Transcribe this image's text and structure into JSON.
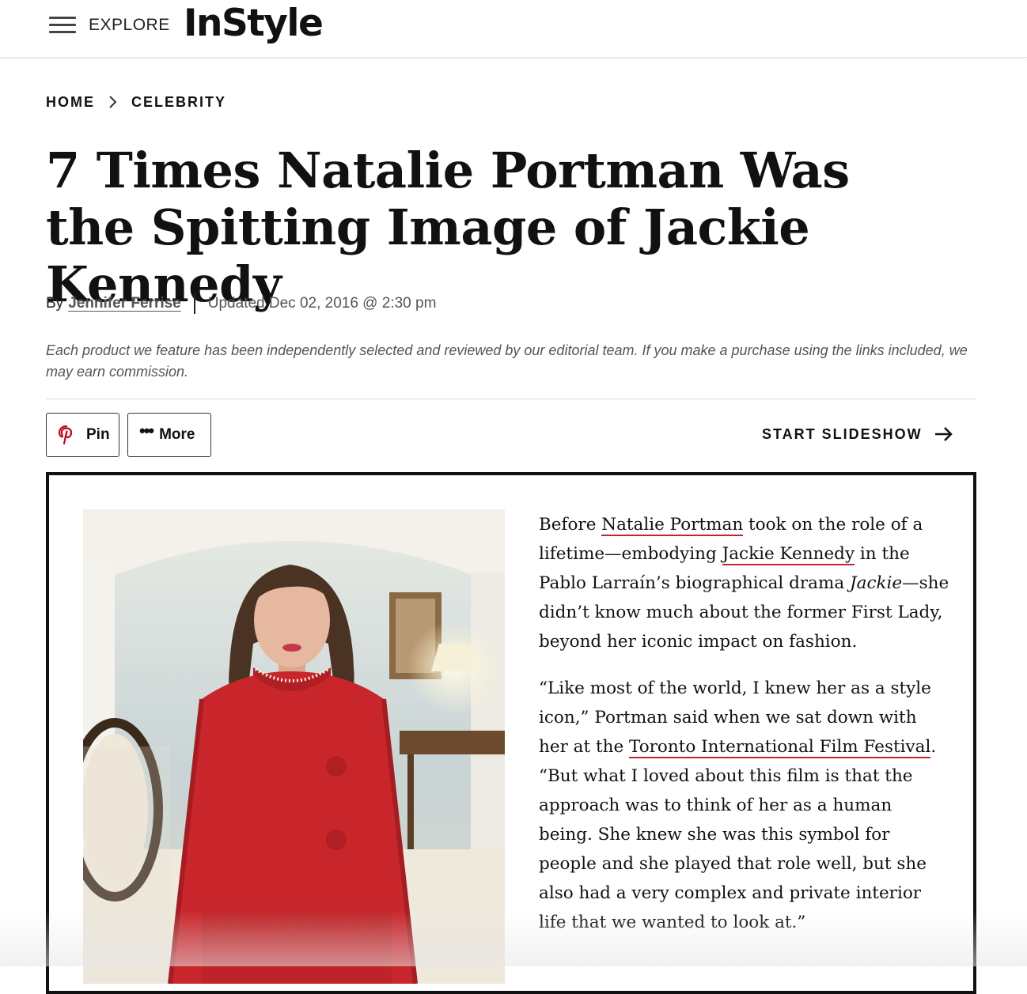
{
  "header": {
    "menu_icon": "hamburger-icon",
    "explore_label": "EXPLORE",
    "logo_text": "InStyle"
  },
  "breadcrumb": {
    "items": [
      "HOME",
      "CELEBRITY"
    ],
    "separator_icon": "chevron-right-icon"
  },
  "article": {
    "title": "7 Times Natalie Portman Was the Spitting Image of Jackie Kennedy",
    "byline_prefix": "By",
    "author": "Jennifer Ferrise",
    "updated": "Updated Dec 02, 2016 @ 2:30 pm",
    "disclaimer": "Each product we feature has been independently selected and reviewed by our editorial team. If you make a purchase using the links included, we may earn commission."
  },
  "actions": {
    "pin_label": "Pin",
    "pin_icon": "pinterest-icon",
    "more_label": "More",
    "more_icon": "ellipsis-icon",
    "slideshow_label": "START SLIDESHOW",
    "slideshow_icon": "arrow-right-icon"
  },
  "slide": {
    "image": "woman-in-red-suit-photo",
    "p1": {
      "t1": "Before ",
      "link1": "Natalie Portman",
      "t2": " took on the role of a lifetime—embodying ",
      "link2": "Jackie Kennedy",
      "t3": " in the Pablo Larraín’s biographical drama ",
      "em": "Jackie",
      "t4": "—she didn’t know much about the former First Lady, beyond her iconic impact on fashion."
    },
    "p2": {
      "t1": "“Like most of the world, I knew her as a style icon,” Portman said when we sat down with her at the ",
      "link1": "Toronto International Film Festival",
      "t2": ". “But what I loved about this film is that the approach was to think of her as a human being. She knew she was this symbol for people and she played that role well, but she also had a very complex and private interior life that we wanted to look at.”"
    }
  },
  "colors": {
    "link_underline": "#c0262e",
    "pinterest": "#bd081c",
    "suit_red": "#c8262b"
  }
}
